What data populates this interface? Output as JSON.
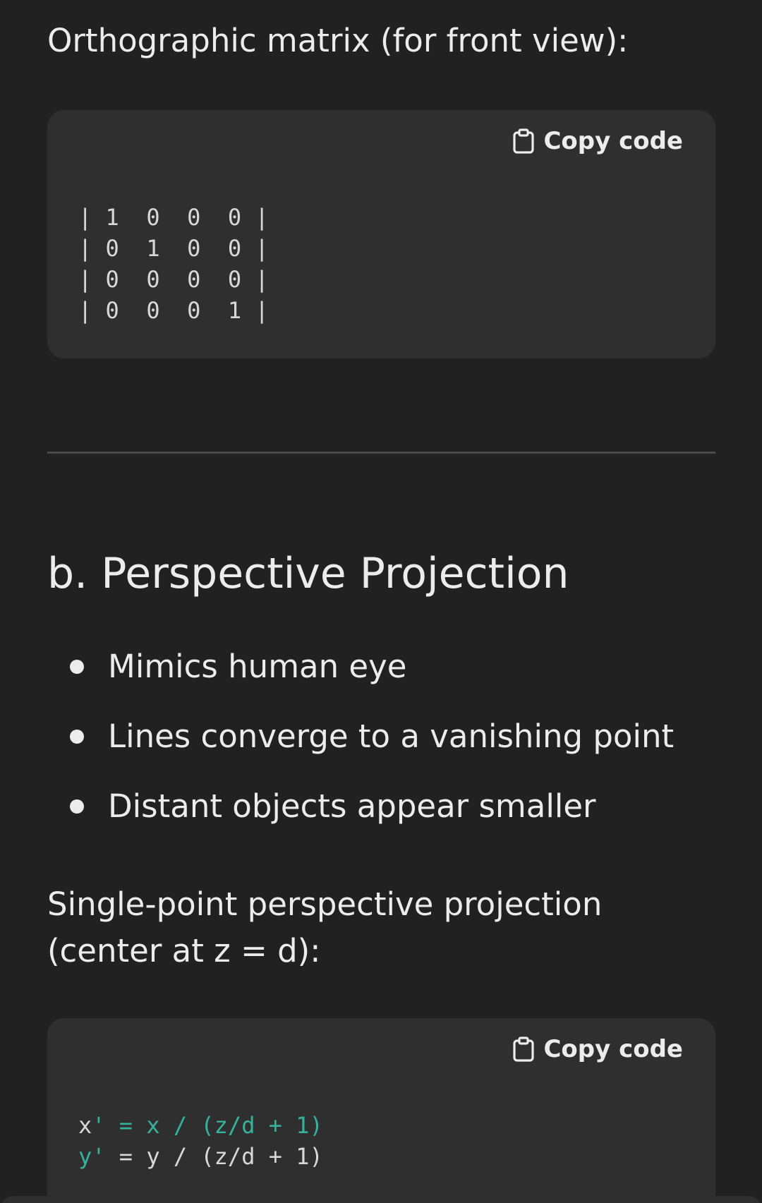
{
  "intro_text": "Orthographic matrix (for front view):",
  "code_blocks": [
    {
      "copy_label": "Copy code",
      "lines": [
        "| 1  0  0  0 |",
        "| 0  1  0  0 |",
        "| 0  0  0  0 |",
        "| 0  0  0  1 |"
      ]
    },
    {
      "copy_label": "Copy code",
      "line1": {
        "a": "x",
        "b": "'",
        "c": " = ",
        "d": "x / (z/d + 1)"
      },
      "line2": {
        "a": "y",
        "b": "'",
        "c": " = y / (z/d + 1)"
      }
    }
  ],
  "section_title": "b. Perspective Projection",
  "bullets": [
    "Mimics human eye",
    "Lines converge to a vanishing point",
    "Distant objects appear smaller"
  ],
  "perspective_text": "Single-point perspective projection (center at z = d):",
  "colors": {
    "background": "#212121",
    "code_background": "#2f2f2f",
    "text": "#ececec",
    "code_accent": "#36b29a"
  }
}
